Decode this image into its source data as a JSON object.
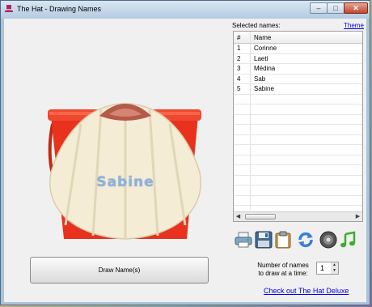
{
  "window": {
    "title": "The Hat - Drawing Names",
    "controls": {
      "minimize": "–",
      "maximize": "□",
      "close": "✕"
    }
  },
  "drawn_name": "Sabine",
  "draw_button": {
    "label": "Draw Name(s)"
  },
  "selected": {
    "label": "Selected names:",
    "theme_link": "Theme",
    "columns": {
      "num": "#",
      "name": "Name"
    },
    "rows": [
      {
        "num": "1",
        "name": "Corinne"
      },
      {
        "num": "2",
        "name": "Laeti"
      },
      {
        "num": "3",
        "name": "Médina"
      },
      {
        "num": "4",
        "name": "Sab"
      },
      {
        "num": "5",
        "name": "Sabine"
      }
    ]
  },
  "toolbar": {
    "icons": [
      "printer-icon",
      "save-icon",
      "clipboard-icon",
      "refresh-icon",
      "speaker-icon",
      "music-note-icon"
    ]
  },
  "count": {
    "label": "Number of names to draw at a time:",
    "value": "1"
  },
  "deluxe_link": "Check out The Hat Deluxe",
  "colors": {
    "bucket": "#e8321e",
    "shell": "#f4ecd4",
    "name_text": "#8fb2dc",
    "link": "#0000ee"
  }
}
